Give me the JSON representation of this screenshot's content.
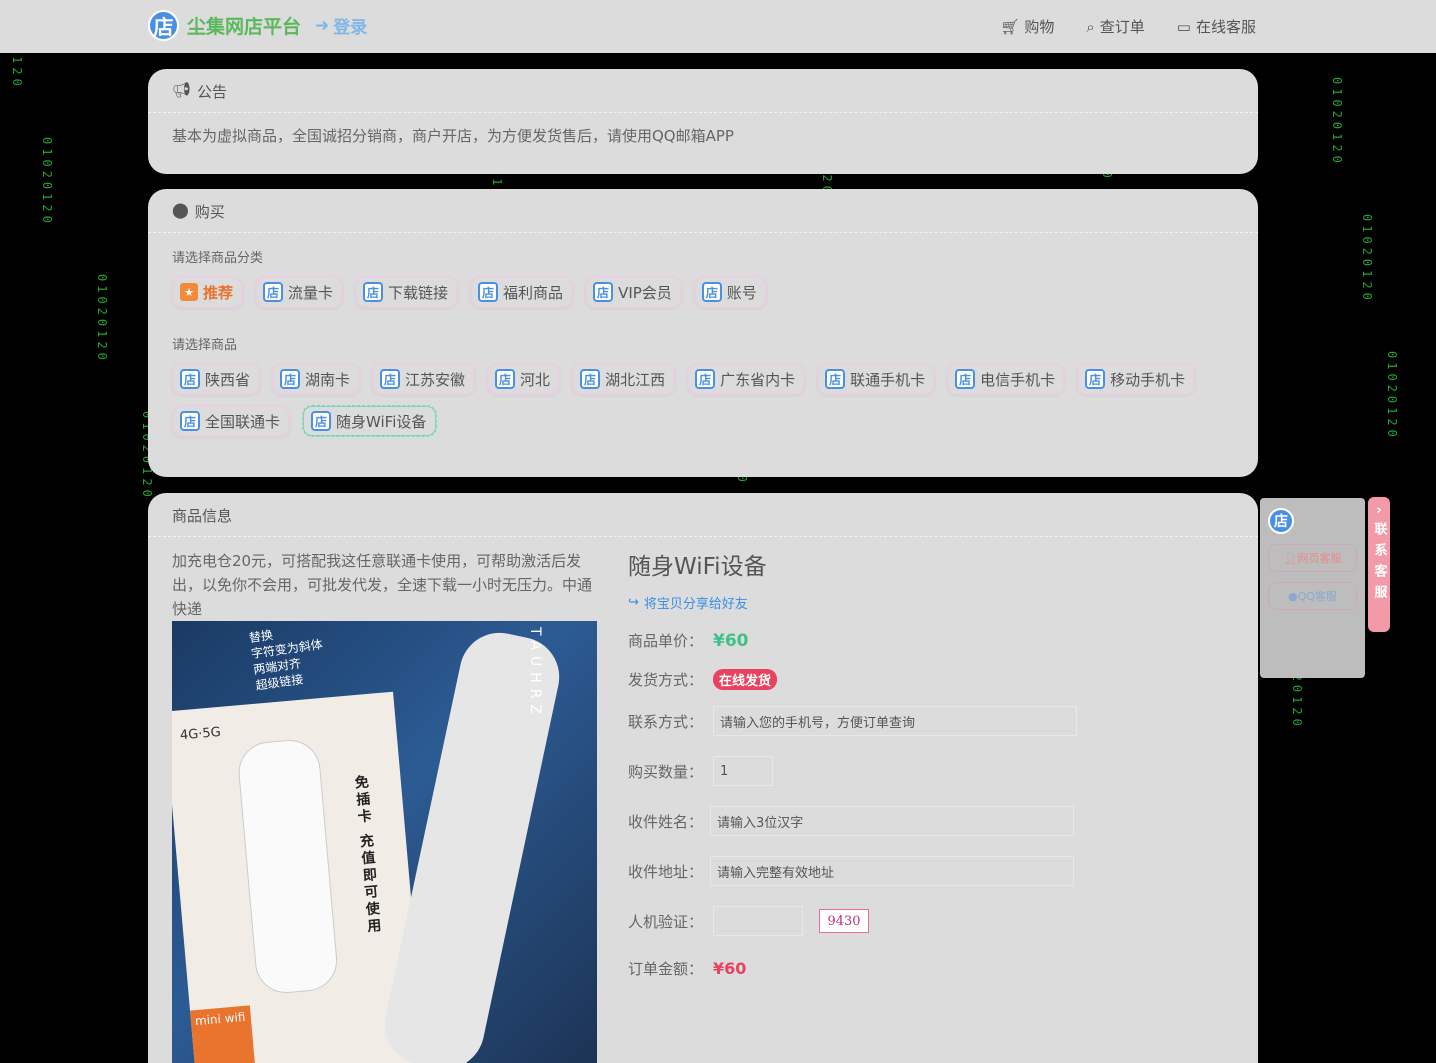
{
  "topbar": {
    "brand_glyph": "店",
    "brand_title": "尘集网店平台",
    "login_label": "登录",
    "nav": [
      {
        "label": "购物",
        "icon": "cart-icon"
      },
      {
        "label": "查订单",
        "icon": "search-icon"
      },
      {
        "label": "在线客服",
        "icon": "chat-icon"
      }
    ]
  },
  "notice": {
    "title": "公告",
    "icon": "bullhorn-icon",
    "text": "基本为虚拟商品，全国诚招分销商，商户开店，为方便发货售后，请使用QQ邮箱APP"
  },
  "buy": {
    "title": "购买",
    "icon": "chevron-circle-icon",
    "category_label": "请选择商品分类",
    "categories": [
      "推荐",
      "流量卡",
      "下载链接",
      "福利商品",
      "VIP会员",
      "账号"
    ],
    "product_label": "请选择商品",
    "products": [
      "陕西省",
      "湖南卡",
      "江苏安徽",
      "河北",
      "湖北江西",
      "广东省内卡",
      "联通手机卡",
      "电信手机卡",
      "移动手机卡",
      "全国联通卡",
      "随身WiFi设备"
    ],
    "selected_product": "随身WiFi设备"
  },
  "product": {
    "panel_title": "商品信息",
    "description": "加充电仓20元，可搭配我这任意联通卡使用，可帮助激活后发出，以免你不会用，可批发代发，全速下载一小时无压力。中通快递",
    "image_text": {
      "top": "替换\n字符变为斜体\n两端对齐\n超级链接",
      "box_tag": "4G·5G",
      "box_vertical": "免插卡 充值即可使用",
      "mini": "mini wifi",
      "side": "TAUHRZ"
    },
    "name": "随身WiFi设备",
    "share_label": "将宝贝分享给好友",
    "price_label": "商品单价：",
    "price": "¥60",
    "ship_label": "发货方式：",
    "ship_value": "在线发货",
    "contact_label": "联系方式：",
    "contact_placeholder": "请输入您的手机号，方便订单查询",
    "qty_label": "购买数量：",
    "qty_value": "1",
    "recipient_label": "收件姓名：",
    "recipient_placeholder": "请输入3位汉字",
    "address_label": "收件地址：",
    "address_placeholder": "请输入完整有效地址",
    "captcha_label": "人机验证：",
    "captcha_value": "",
    "captcha_code": "9430",
    "total_label": "订单金额：",
    "total": "¥60"
  },
  "float_service": {
    "logo_text": "",
    "btn1": "网页客服",
    "btn2": "QQ客服",
    "tab_label": "联系客服"
  },
  "colors": {
    "brand": "#5cb85c",
    "accent": "#3a8ee6",
    "price": "#3fc18a",
    "badge": "#e8425e",
    "panel": "#dcdcdc"
  }
}
